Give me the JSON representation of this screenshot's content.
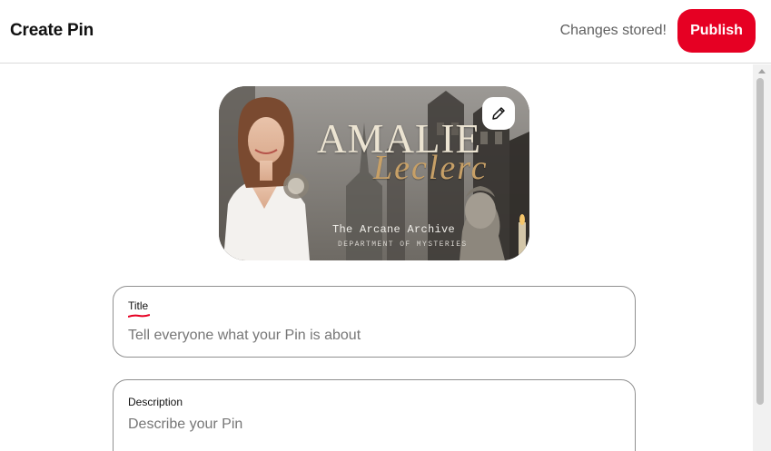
{
  "header": {
    "title": "Create Pin",
    "status": "Changes stored!",
    "publish_label": "Publish"
  },
  "pin_image": {
    "title_text": "AMALIE",
    "script_text": "Leclerc",
    "subtitle": "The Arcane Archive",
    "tagline": "DEPARTMENT OF MYSTERIES",
    "edit_icon": "pencil-icon"
  },
  "form": {
    "title_field": {
      "label": "Title",
      "value": "",
      "placeholder": "Tell everyone what your Pin is about"
    },
    "description_field": {
      "label": "Description",
      "value": "",
      "placeholder": "Describe your Pin"
    }
  },
  "colors": {
    "accent": "#e60023",
    "spellcheck_underline": "#e60023",
    "border": "#909090",
    "muted_text": "#5f5f5f"
  }
}
